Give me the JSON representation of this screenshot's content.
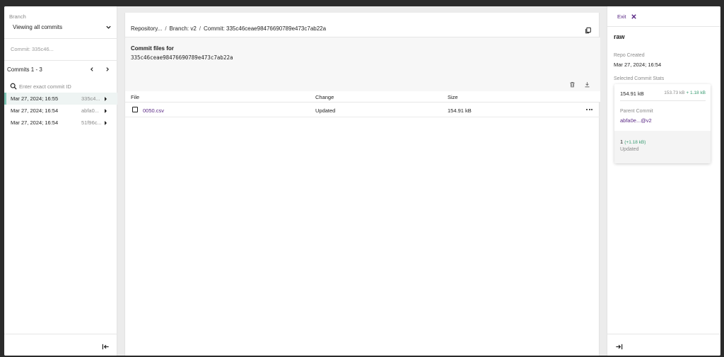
{
  "left_sidebar": {
    "branch_label": "Branch",
    "branch_value": "Viewing all commits",
    "commit_crumb": "Commit: 335c46...",
    "commits_title": "Commits 1 - 3",
    "search_placeholder": "Enter exact commit ID",
    "commits": [
      {
        "date": "Mar 27, 2024; 16:55",
        "hash": "335c4...",
        "selected": true
      },
      {
        "date": "Mar 27, 2024; 16:54",
        "hash": "abfa0...",
        "selected": false
      },
      {
        "date": "Mar 27, 2024; 16:54",
        "hash": "51f96c...",
        "selected": false
      }
    ]
  },
  "breadcrumb": {
    "repo": "Repository...",
    "sep1": "/",
    "branch": "Branch: v2",
    "sep2": "/",
    "commit": "Commit: 335c46ceae98476690789e473c7ab22a"
  },
  "files_panel": {
    "title": "Commit files for",
    "hash": "335c46ceae98476690789e473c7ab22a"
  },
  "table": {
    "columns": [
      "File",
      "Change",
      "Size"
    ],
    "rows": [
      {
        "file": "0050.csv",
        "change": "Updated",
        "size": "154.91 kB"
      }
    ]
  },
  "right_panel": {
    "exit_label": "Exit",
    "repo_name": "raw",
    "repo_created_label": "Repo Created",
    "repo_created_value": "Mar 27, 2024; 16:54",
    "stats_label": "Selected Commit Stats",
    "size": "154.91 kB",
    "prev_size": "153.73 kB",
    "size_delta": "+ 1.18 kB",
    "parent_commit_label": "Parent Commit",
    "parent_commit_value": "abfa0e...@v2",
    "changed_count": "1",
    "changed_delta": "(+1.18 kB)",
    "changed_type": "Updated"
  },
  "colors": {
    "accent_purple": "#5b2a86",
    "selection_teal": "#7fc4b5",
    "positive_green": "#3a9c73"
  }
}
